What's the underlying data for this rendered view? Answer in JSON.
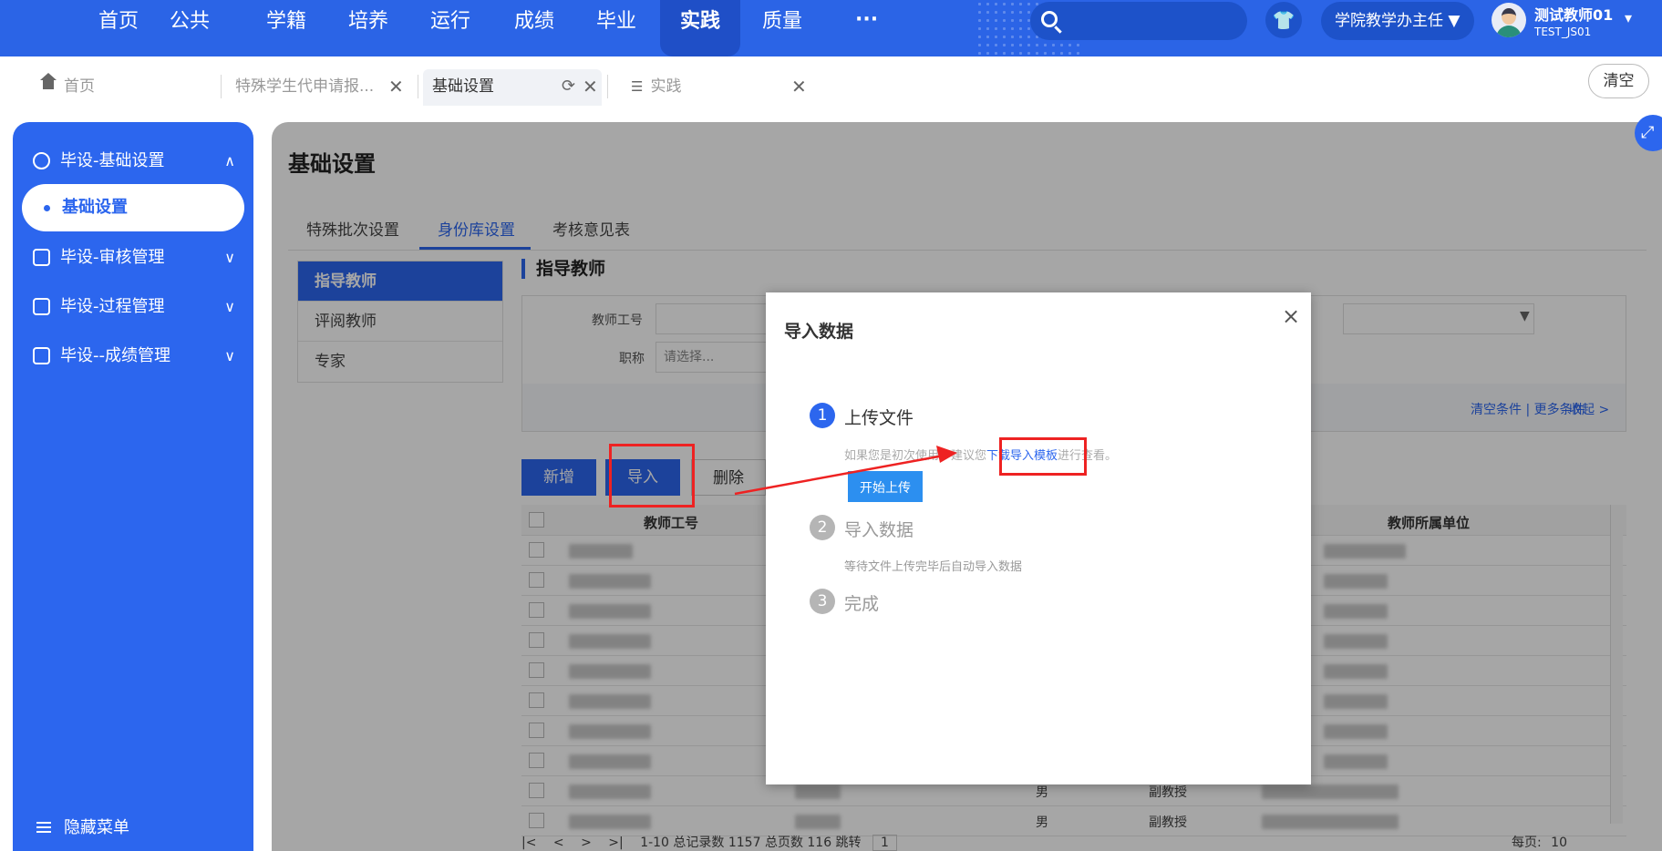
{
  "topnav": {
    "items": [
      "首页",
      "公共",
      "学籍",
      "培养",
      "运行",
      "成绩",
      "毕业",
      "实践",
      "质量"
    ],
    "active": "实践",
    "more": "···",
    "search_placeholder": "",
    "role": "学院教学办主任",
    "role_arrow": "▼",
    "user_name": "测试教师01",
    "user_id": "TEST_JS01",
    "user_arrow": "▾",
    "skin_icon": "shirt-icon"
  },
  "tabs": {
    "items": [
      {
        "label": "首页",
        "icon": "home-icon"
      },
      {
        "label": "特殊学生代申请报...",
        "close": "✕"
      },
      {
        "label": "基础设置",
        "refresh": "⟳",
        "close": "✕"
      },
      {
        "label": "实践",
        "icon": "list-icon",
        "close": "✕"
      }
    ],
    "clear_label": "清空"
  },
  "sidebar": {
    "groups": [
      {
        "label": "毕设-基础设置",
        "chevron": "∧"
      },
      {
        "label": "毕设-审核管理",
        "chevron": "∨"
      },
      {
        "label": "毕设-过程管理",
        "chevron": "∨"
      },
      {
        "label": "毕设--成绩管理",
        "chevron": "∨"
      }
    ],
    "active_sub": "基础设置",
    "hide_label": "隐藏菜单"
  },
  "main": {
    "title": "基础设置",
    "subtabs": [
      "特殊批次设置",
      "身份库设置",
      "考核意见表"
    ],
    "active_subtab": "身份库设置",
    "left_menu": [
      "指导教师",
      "评阅教师",
      "专家"
    ],
    "section_title": "指导教师",
    "filters": {
      "teacher_id_label": "教师工号",
      "title_label": "职称",
      "title_placeholder": "请选择...",
      "links": "清空条件 | 更多条件",
      "collapse": "收起 >"
    },
    "buttons": {
      "add": "新增",
      "import": "导入",
      "delete": "删除"
    },
    "table": {
      "headers": [
        "教师工号",
        "教师所属单位"
      ],
      "partial_rows": [
        {
          "gender": "男",
          "title": "副教授"
        },
        {
          "gender": "男",
          "title": "副教授"
        }
      ]
    },
    "pager": {
      "nav": [
        "|<",
        "<",
        ">",
        ">|"
      ],
      "summary": "1-10 总记录数 1157    总页数 116    跳转",
      "jump_value": "1",
      "page_size_label": "每页:",
      "page_size": "10"
    }
  },
  "modal": {
    "title": "导入数据",
    "close": "×",
    "steps": [
      {
        "num": "1",
        "title": "上传文件"
      },
      {
        "num": "2",
        "title": "导入数据",
        "desc": "等待文件上传完毕后自动导入数据"
      },
      {
        "num": "3",
        "title": "完成"
      }
    ],
    "step1_desc_pre": "如果您是初次使用，建议您",
    "step1_link": "下载导入模板",
    "step1_desc_post": "进行查看。",
    "upload_button": "开始上传"
  },
  "colors": {
    "primary": "#2c66ee",
    "annotation": "#ee2222"
  }
}
